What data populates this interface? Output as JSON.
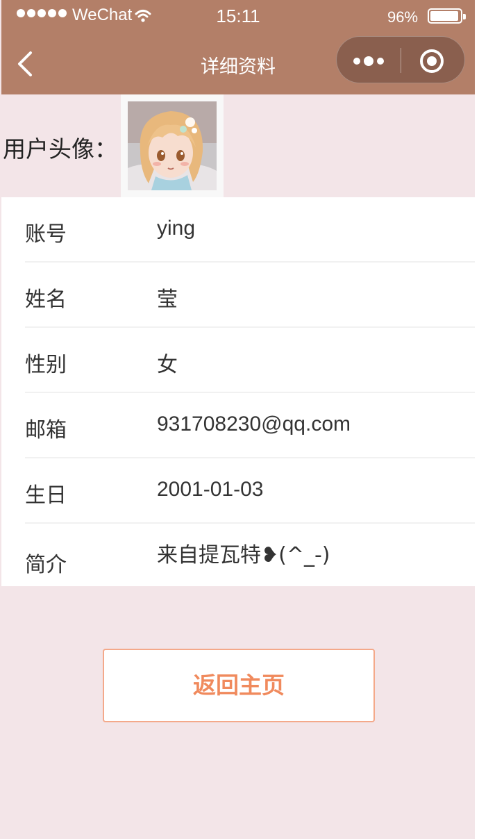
{
  "status_bar": {
    "carrier": "WeChat",
    "time": "15:11",
    "battery": "96%",
    "battery_level": 0.96
  },
  "nav": {
    "title": "详细资料",
    "back_icon": "chevron-left-icon",
    "more_icon": "more-dots-icon",
    "close_icon": "target-circle-icon"
  },
  "profile": {
    "avatar_label": "用户头像：",
    "rows": [
      {
        "label": "账号",
        "value": "ying"
      },
      {
        "label": "姓名",
        "value": "莹"
      },
      {
        "label": "性别",
        "value": "女"
      },
      {
        "label": "邮箱",
        "value": "931708230@qq.com"
      },
      {
        "label": "生日",
        "value": "2001-01-03"
      },
      {
        "label": "简介",
        "value": "来自提瓦特❥(^_-)"
      }
    ]
  },
  "actions": {
    "home_button": "返回主页"
  },
  "colors": {
    "header": "#b37f68",
    "background": "#f3e5e8",
    "button_text": "#f08a5d",
    "button_border": "#f4a98a"
  }
}
